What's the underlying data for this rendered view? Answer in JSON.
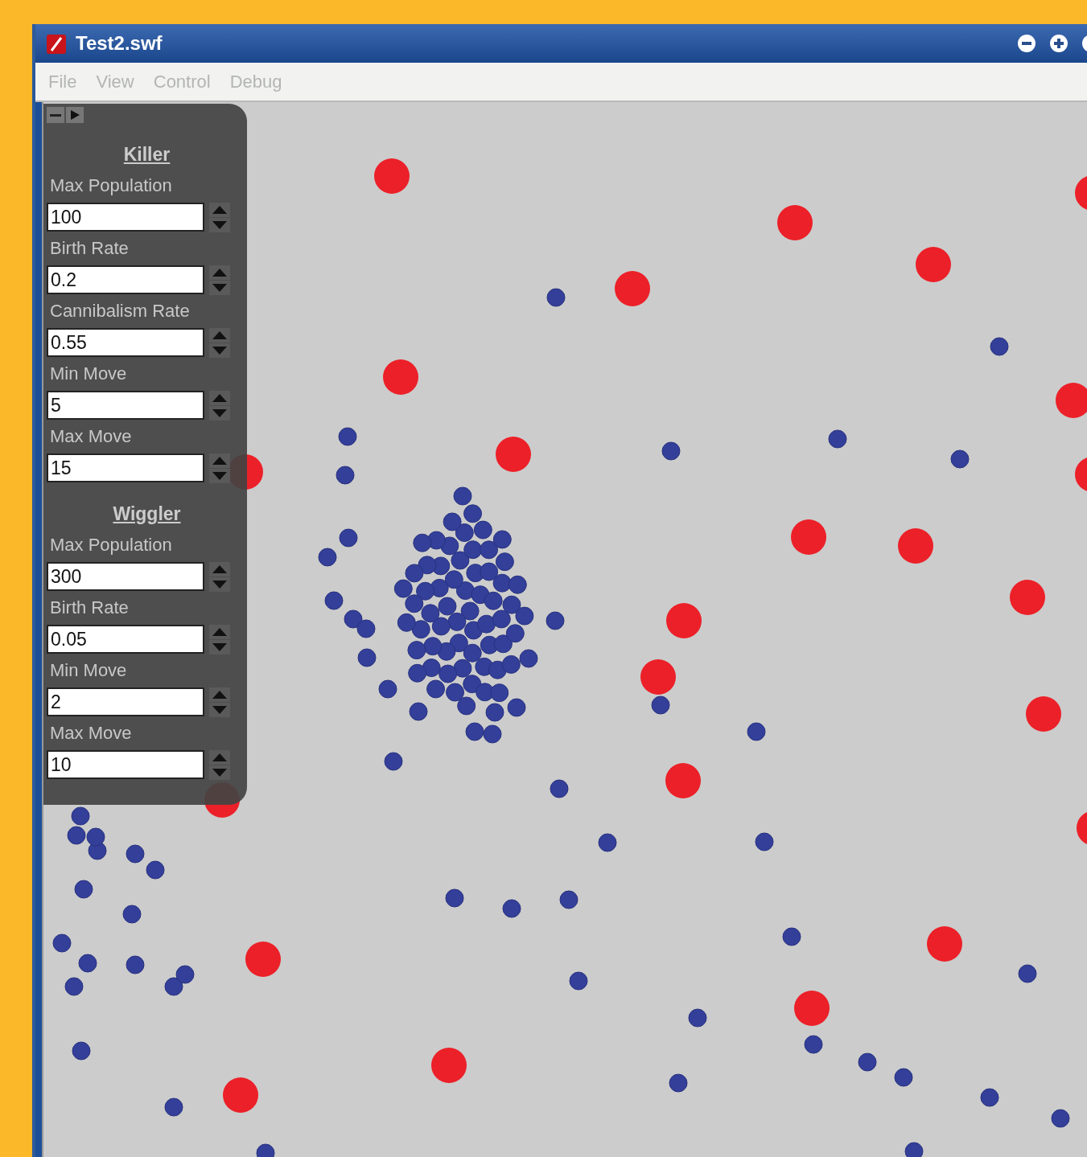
{
  "window": {
    "title": "Test2.swf"
  },
  "menu": [
    {
      "label": "File",
      "disabled": true
    },
    {
      "label": "View",
      "disabled": true
    },
    {
      "label": "Control",
      "disabled": true
    },
    {
      "label": "Debug",
      "disabled": true
    }
  ],
  "panel": {
    "sections": [
      {
        "title": "Killer",
        "fields": [
          {
            "label": "Max Population",
            "value": "100"
          },
          {
            "label": "Birth Rate",
            "value": "0.2"
          },
          {
            "label": "Cannibalism Rate",
            "value": "0.55"
          },
          {
            "label": "Min Move",
            "value": "5"
          },
          {
            "label": "Max Move",
            "value": "15"
          }
        ]
      },
      {
        "title": "Wiggler",
        "fields": [
          {
            "label": "Max Population",
            "value": "300"
          },
          {
            "label": "Birth Rate",
            "value": "0.05"
          },
          {
            "label": "Min Move",
            "value": "2"
          },
          {
            "label": "Max Move",
            "value": "10"
          }
        ]
      }
    ]
  }
}
